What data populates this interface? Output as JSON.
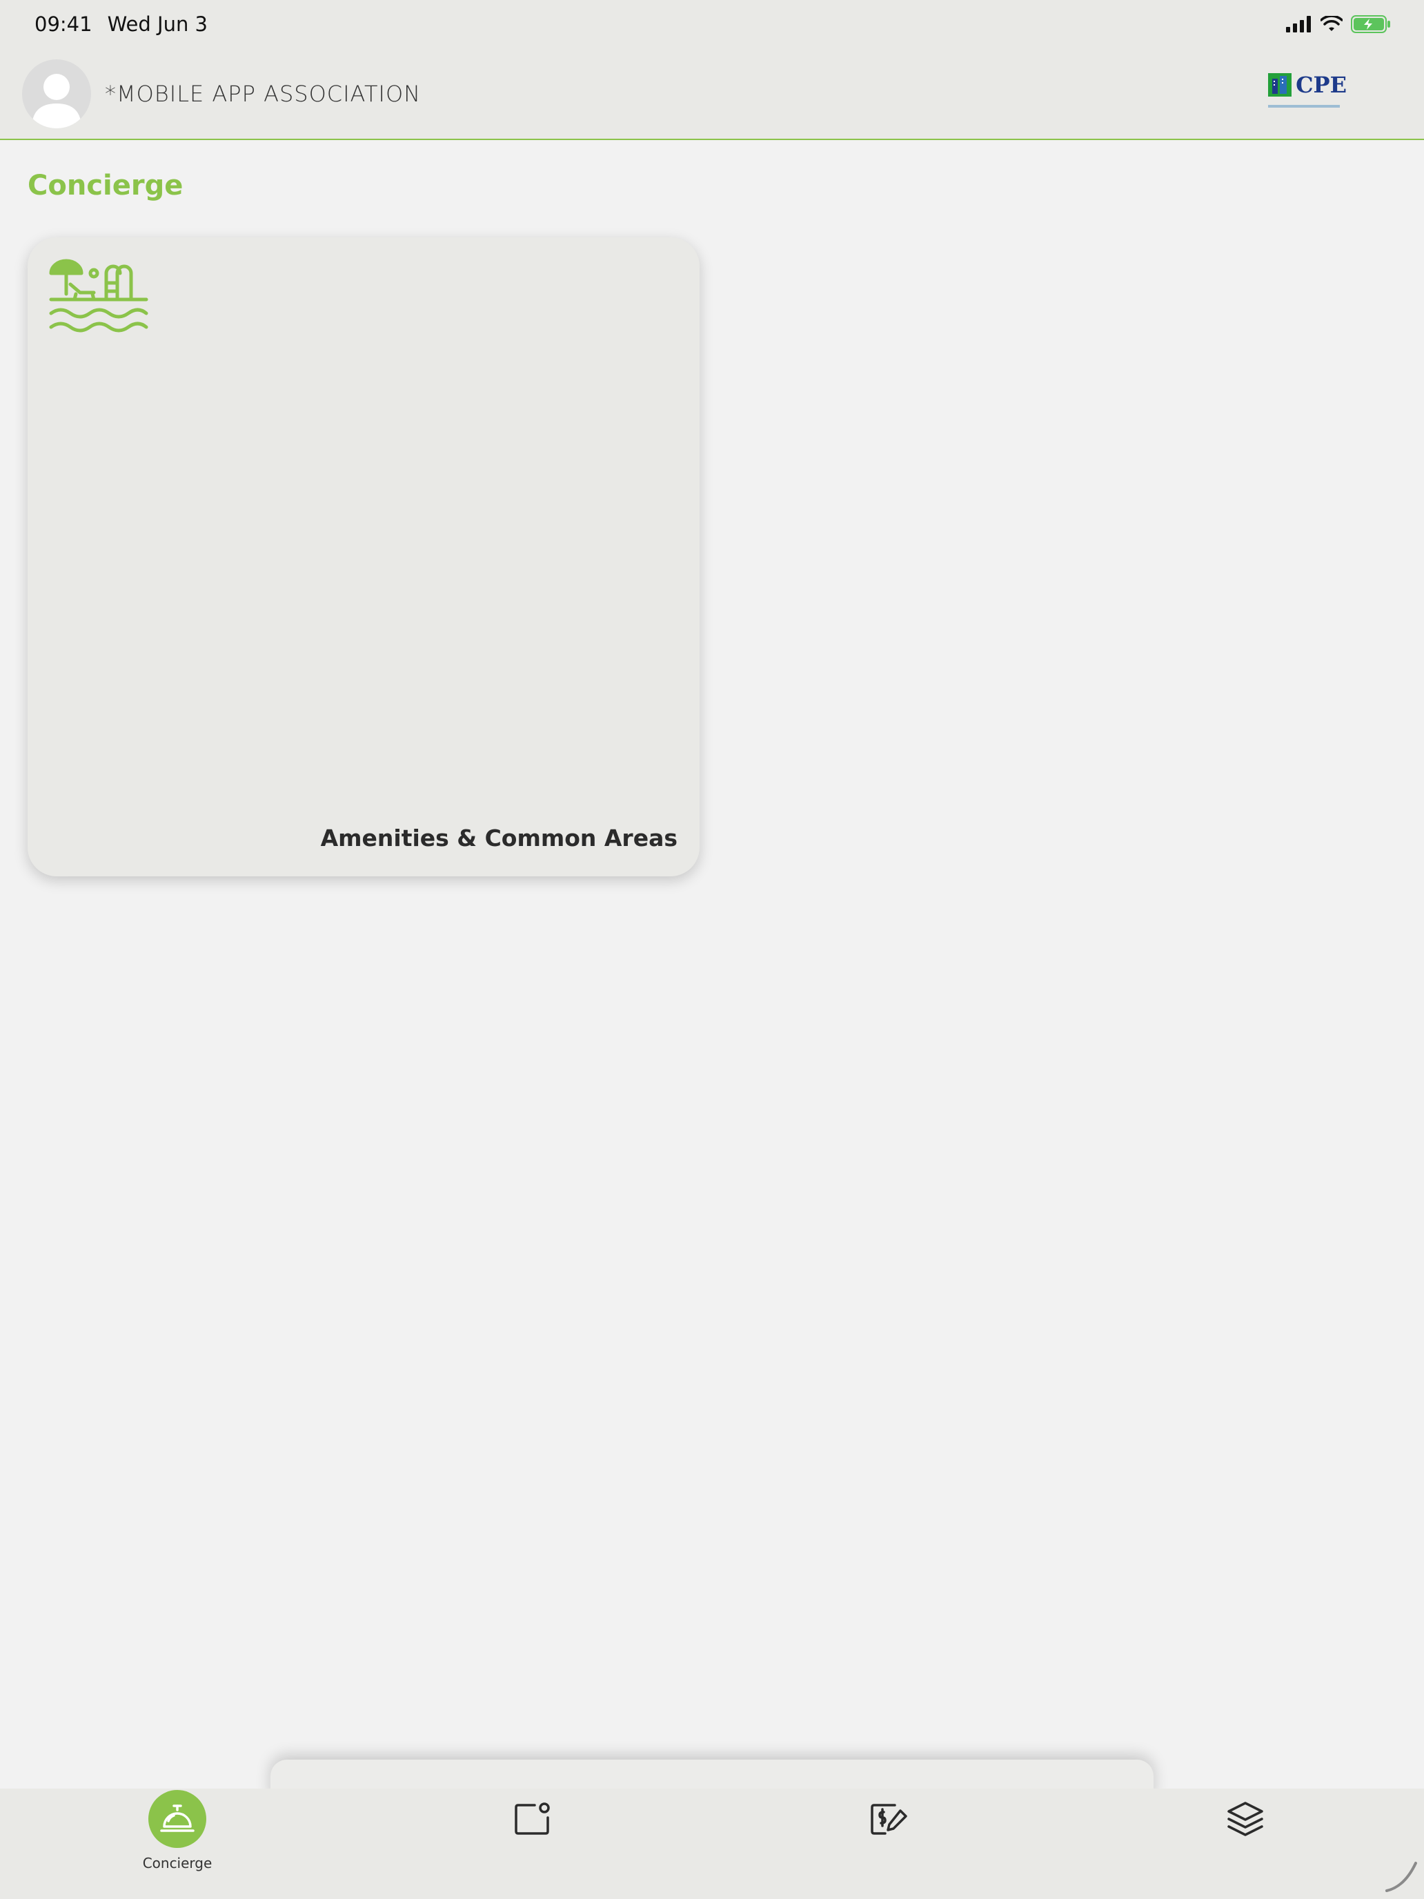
{
  "status_bar": {
    "time": "09:41",
    "date": "Wed Jun 3"
  },
  "header": {
    "org_name": "*MOBILE APP ASSOCIATION",
    "logo_text": "CPE"
  },
  "page": {
    "title": "Concierge"
  },
  "cards": [
    {
      "label": "Amenities & Common Areas",
      "icon": "pool-beach-icon"
    }
  ],
  "tabs": [
    {
      "label": "Concierge",
      "icon": "concierge-bell-icon",
      "active": true
    },
    {
      "label": "",
      "icon": "message-board-icon",
      "active": false
    },
    {
      "label": "",
      "icon": "payment-edit-icon",
      "active": false
    },
    {
      "label": "",
      "icon": "layers-icon",
      "active": false
    }
  ],
  "colors": {
    "accent": "#8bc34a",
    "header_bg": "#e9e9e6",
    "page_bg": "#f2f2f2",
    "logo_blue": "#1d3a8a"
  }
}
